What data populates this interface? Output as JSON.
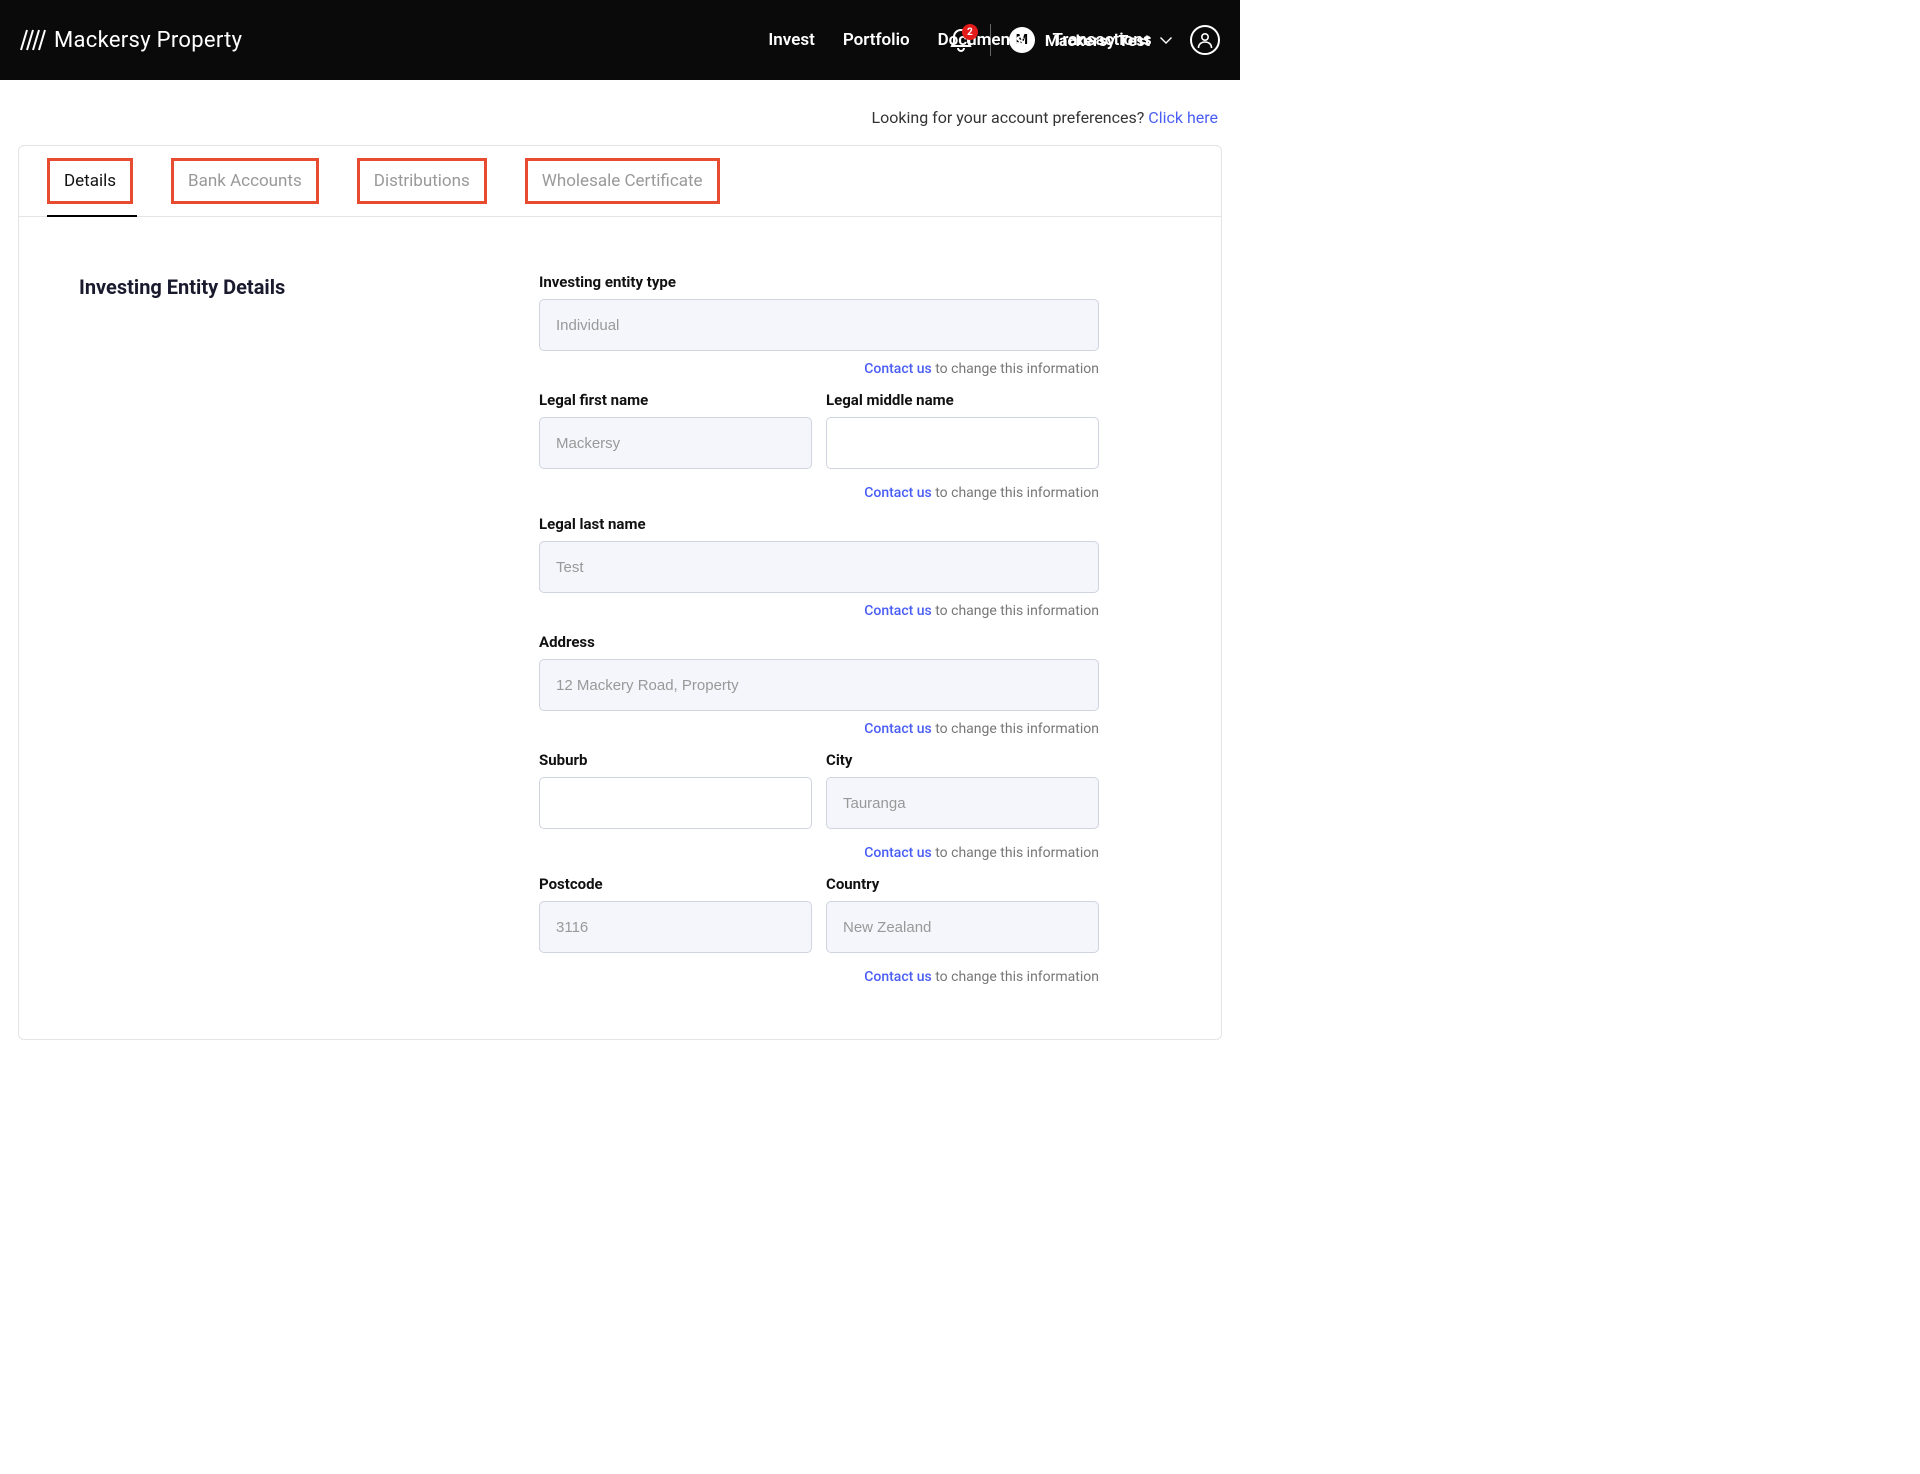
{
  "header": {
    "brand": "Mackersy Property",
    "nav": {
      "invest": "Invest",
      "portfolio": "Portfolio",
      "documents": "Documents",
      "transactions": "Transactions"
    },
    "notification_count": "2",
    "user": {
      "initial": "M",
      "name": "Mackersy Test"
    }
  },
  "prefs": {
    "text": "Looking for your account preferences?  ",
    "link": "Click here"
  },
  "tabs": {
    "details": "Details",
    "bank": "Bank Accounts",
    "dist": "Distributions",
    "wholesale": "Wholesale Certificate"
  },
  "section_title": "Investing Entity Details",
  "help": {
    "link": "Contact us",
    "rest": " to change this information"
  },
  "fields": {
    "entity_type": {
      "label": "Investing entity type",
      "value": "Individual"
    },
    "first_name": {
      "label": "Legal first name",
      "value": "Mackersy"
    },
    "middle_name": {
      "label": "Legal middle name",
      "value": ""
    },
    "last_name": {
      "label": "Legal last name",
      "value": "Test"
    },
    "address": {
      "label": "Address",
      "value": "12 Mackery Road, Property"
    },
    "suburb": {
      "label": "Suburb",
      "value": ""
    },
    "city": {
      "label": "City",
      "value": "Tauranga"
    },
    "postcode": {
      "label": "Postcode",
      "value": "3116"
    },
    "country": {
      "label": "Country",
      "value": "New Zealand"
    }
  }
}
